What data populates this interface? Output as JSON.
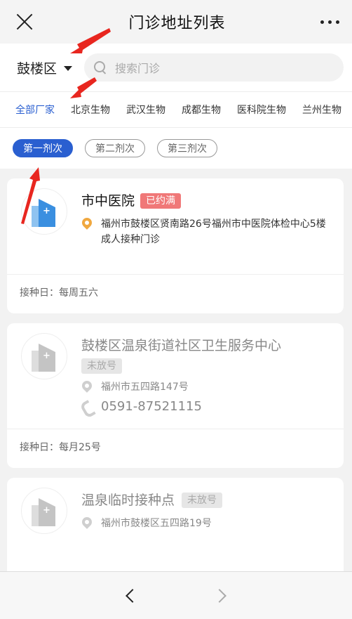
{
  "nav": {
    "title": "门诊地址列表"
  },
  "search": {
    "district": "鼓楼区",
    "placeholder": "搜索门诊"
  },
  "tabs": [
    "全部厂家",
    "北京生物",
    "武汉生物",
    "成都生物",
    "医科院生物",
    "兰州生物"
  ],
  "doses": [
    "第一剂次",
    "第二剂次",
    "第三剂次"
  ],
  "clinics": [
    {
      "name": "市中医院",
      "badge": "已约满",
      "address": "福州市鼓楼区贤南路26号福州市中医院体检中心5楼成人接种门诊",
      "footer": "接种日：每周五六"
    },
    {
      "name": "鼓楼区温泉街道社区卫生服务中心",
      "badge": "未放号",
      "address": "福州市五四路147号",
      "phone": "0591-87521115",
      "footer": "接种日：每月25号"
    },
    {
      "name": "温泉临时接种点",
      "badge": "未放号",
      "address": "福州市鼓楼区五四路19号"
    }
  ],
  "colors": {
    "accent": "#2a5fd0",
    "full_badge": "#f07878",
    "arrow": "#e8261f"
  }
}
